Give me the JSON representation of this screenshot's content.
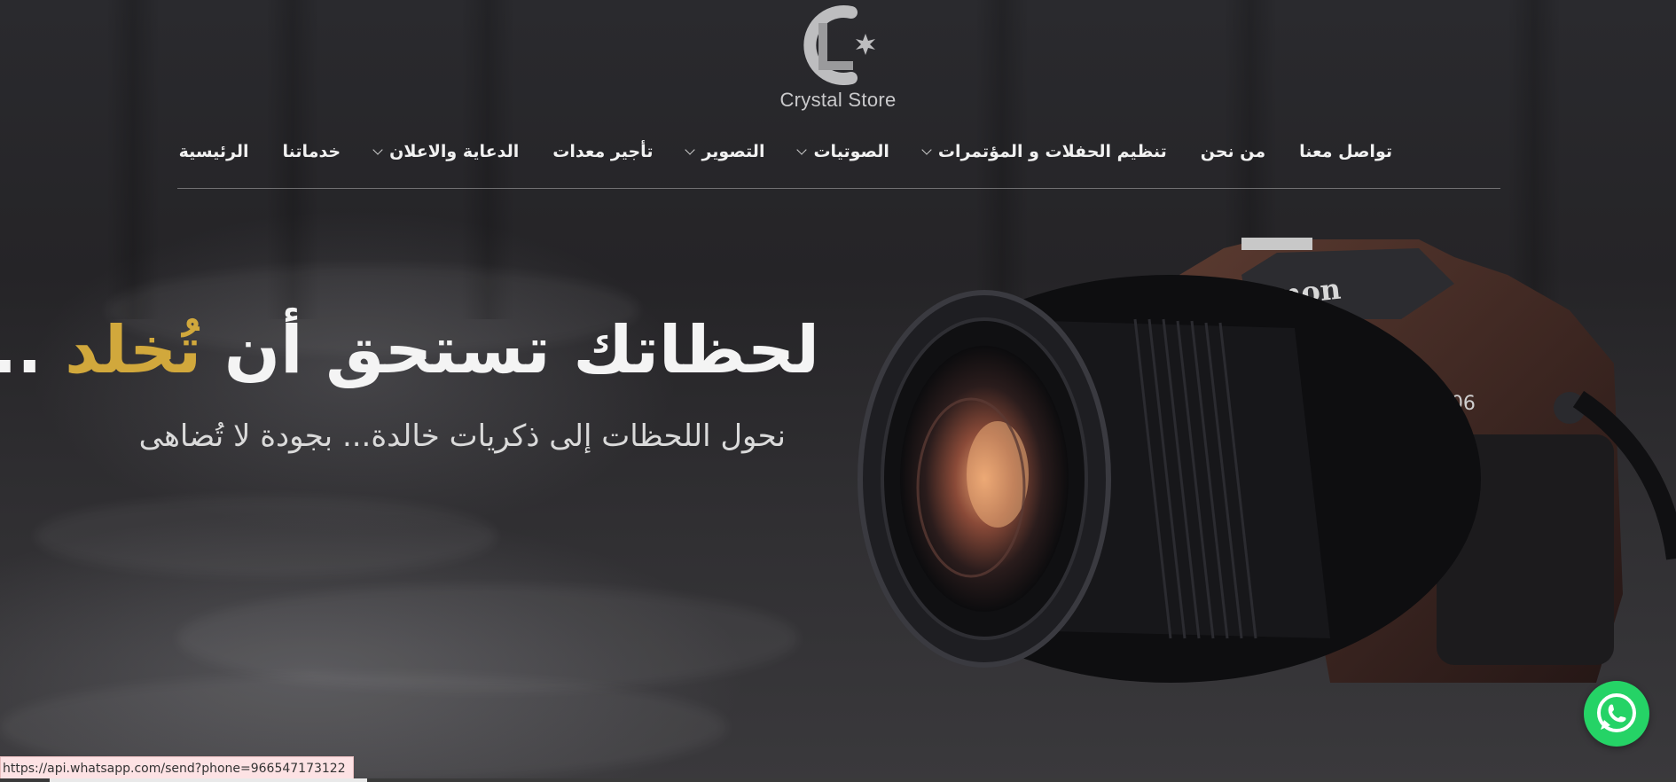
{
  "brand": {
    "name": "Crystal Store"
  },
  "nav": {
    "items": [
      {
        "label": "الرئيسية",
        "dropdown": false
      },
      {
        "label": "خدماتنا",
        "dropdown": false
      },
      {
        "label": "الدعاية والاعلان",
        "dropdown": true
      },
      {
        "label": "تأجير معدات",
        "dropdown": false
      },
      {
        "label": "التصوير",
        "dropdown": true
      },
      {
        "label": "الصوتيات",
        "dropdown": true
      },
      {
        "label": "تنظيم الحفلات و المؤتمرات",
        "dropdown": true
      },
      {
        "label": "من نحن",
        "dropdown": false
      },
      {
        "label": "تواصل معنا",
        "dropdown": false
      }
    ]
  },
  "hero": {
    "headline_start": "لحظاتك تستحق أن ",
    "headline_highlight": "تُخلد",
    "headline_end": " ...",
    "subtitle": "نحول اللحظات إلى ذكريات خالدة... بجودة لا تُضاهى",
    "camera_brand": "Cmon",
    "camera_model": "-06"
  },
  "whatsapp": {
    "icon": "whatsapp-icon"
  },
  "status_bar": {
    "url": "https://api.whatsapp.com/send?phone=966547173122"
  },
  "colors": {
    "accent_gold": "#d1a83c",
    "whatsapp_green": "#25d366",
    "nav_text": "#f1f1f1"
  }
}
